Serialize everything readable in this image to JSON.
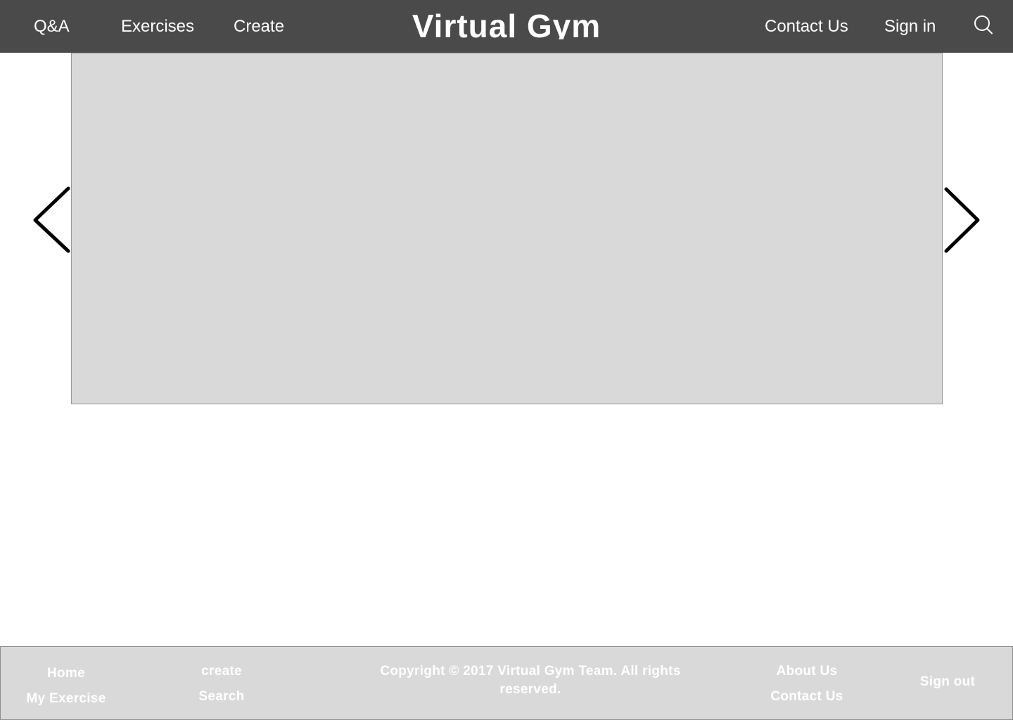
{
  "header": {
    "nav_left": [
      "Q&A",
      "Exercises",
      "Create"
    ],
    "brand": "Virtual Gym",
    "nav_right": [
      "Contact Us",
      "Sign in"
    ],
    "search_icon": "search-icon",
    "background_color": "#4a4a4a"
  },
  "carousel": {
    "prev_icon": "chevron-left-icon",
    "next_icon": "chevron-right-icon",
    "slide_color": "#d9d9d9"
  },
  "footer": {
    "col1": [
      "Home",
      "My Exercise"
    ],
    "col2": [
      "create",
      "Search"
    ],
    "copyright": "Copyright © 2017 Virtual Gym Team. All rights reserved.",
    "col4": [
      "About Us",
      "Contact Us"
    ],
    "col5": "Sign out",
    "background_color": "#d9d9d9"
  }
}
